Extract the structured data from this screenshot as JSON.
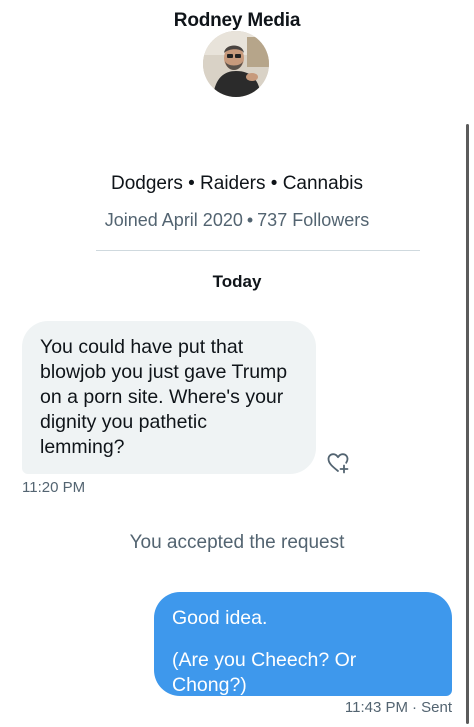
{
  "profile": {
    "name": "Rodney Media",
    "bio": "Dodgers • Raiders • Cannabis",
    "joined": "Joined April 2020",
    "separator": "•",
    "followers": "737 Followers"
  },
  "conversation": {
    "day_label": "Today",
    "messages": [
      {
        "direction": "incoming",
        "text": "You could have put that\nblowjob you just gave Trump\non a porn site. Where's your\ndignity you pathetic\nlemming?",
        "time": "11:20 PM"
      },
      {
        "direction": "outgoing",
        "lines": [
          "Good idea.",
          "(Are you Cheech? Or Chong?)"
        ],
        "time": "11:43 PM",
        "status": "· Sent"
      }
    ],
    "system_message": "You accepted the request"
  },
  "icons": {
    "react": "heart-plus-icon"
  },
  "colors": {
    "outgoing_bubble": "#3e98ec",
    "incoming_bubble": "#eff3f4",
    "secondary_text": "#536471",
    "primary_text": "#0f1419"
  }
}
